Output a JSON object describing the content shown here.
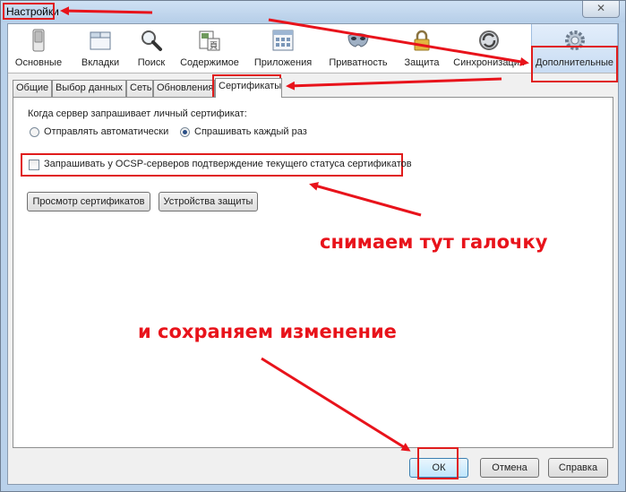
{
  "window": {
    "title": "Настройки",
    "close_glyph": "✕"
  },
  "toolbar": {
    "items": [
      {
        "label": "Основные",
        "icon": "switch-icon"
      },
      {
        "label": "Вкладки",
        "icon": "tabs-icon"
      },
      {
        "label": "Поиск",
        "icon": "search-icon"
      },
      {
        "label": "Содержимое",
        "icon": "content-icon"
      },
      {
        "label": "Приложения",
        "icon": "applications-icon"
      },
      {
        "label": "Приватность",
        "icon": "mask-icon"
      },
      {
        "label": "Защита",
        "icon": "lock-icon"
      },
      {
        "label": "Синхронизация",
        "icon": "sync-icon"
      },
      {
        "label": "Дополнительные",
        "icon": "gear-icon",
        "selected": true
      }
    ]
  },
  "tabs": [
    {
      "label": "Общие"
    },
    {
      "label": "Выбор данных"
    },
    {
      "label": "Сеть"
    },
    {
      "label": "Обновления"
    },
    {
      "label": "Сертификаты",
      "active": true
    }
  ],
  "certificates": {
    "request_label": "Когда сервер запрашивает личный сертификат:",
    "radio_auto": {
      "label": "Отправлять автоматически",
      "checked": false
    },
    "radio_ask": {
      "label": "Спрашивать каждый раз",
      "checked": true
    },
    "ocsp_checkbox": {
      "label": "Запрашивать у OCSP-серверов подтверждение текущего статуса сертификатов",
      "checked": false
    },
    "view_certs_button": "Просмотр сертификатов",
    "security_devices_button": "Устройства защиты"
  },
  "footer": {
    "ok": "ОК",
    "cancel": "Отмена",
    "help": "Справка"
  },
  "annotations": {
    "uncheck_here": "снимаем тут галочку",
    "save_change": "и сохраняем изменение",
    "color": "#e8131b"
  }
}
